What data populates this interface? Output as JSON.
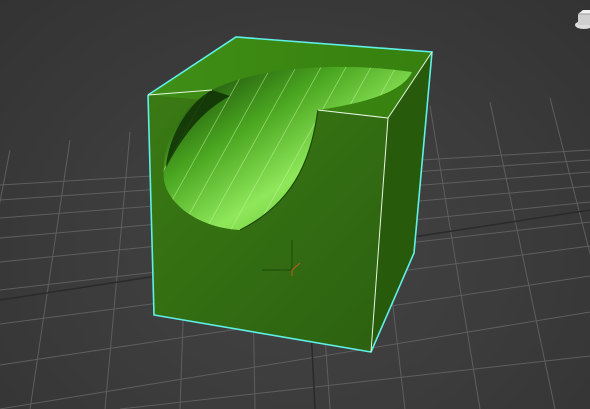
{
  "viewport": {
    "background_color": "#3b3b3b",
    "grid_color": "#5a5a5a",
    "selection_color": "#5ff0e6"
  },
  "object": {
    "type": "box-with-cut",
    "face_color_front": "#2f6b10",
    "face_color_top": "#3c8a14",
    "face_color_side": "#285a0c",
    "cut_highlight": "#8fe85a",
    "cut_shadow": "#123a06",
    "selected": true
  },
  "gizmos": {
    "pivot": "transform-axis-icon",
    "viewcube": "viewcube-icon"
  }
}
